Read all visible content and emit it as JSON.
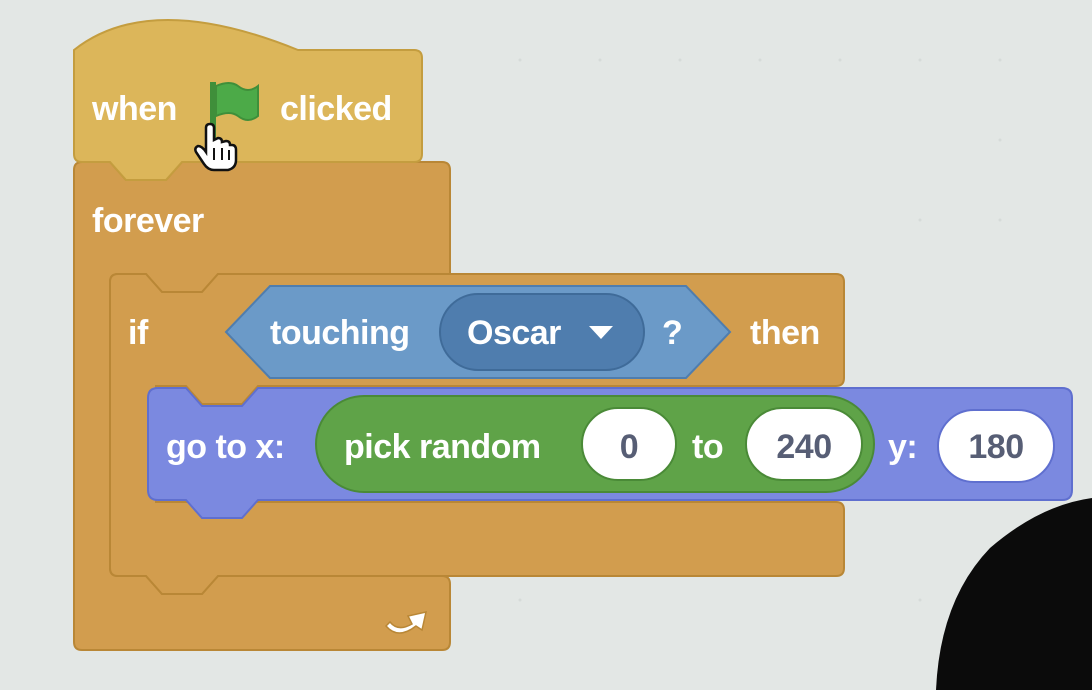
{
  "event_block": {
    "prefix": "when",
    "suffix": "clicked",
    "flag_icon": "green-flag-icon",
    "cursor_icon": "hand-pointer-cursor-icon"
  },
  "forever_block": {
    "label": "forever",
    "loop_icon": "loop-arrow-icon"
  },
  "if_block": {
    "label_if": "if",
    "label_then": "then"
  },
  "touching_block": {
    "label": "touching",
    "question": "?",
    "dropdown_value": "Oscar",
    "dropdown_icon": "dropdown-triangle-icon"
  },
  "goto_block": {
    "label_x": "go to x:",
    "label_y": "y:",
    "y_value": "180"
  },
  "random_block": {
    "label": "pick random",
    "label_to": "to",
    "from_value": "0",
    "to_value": "240"
  },
  "colors": {
    "events": "#ffbf00",
    "control": "#ffab19",
    "sensing": "#5cb1d6",
    "motion": "#4c97ff",
    "operators": "#59c059",
    "background": "#e3e7e5"
  }
}
